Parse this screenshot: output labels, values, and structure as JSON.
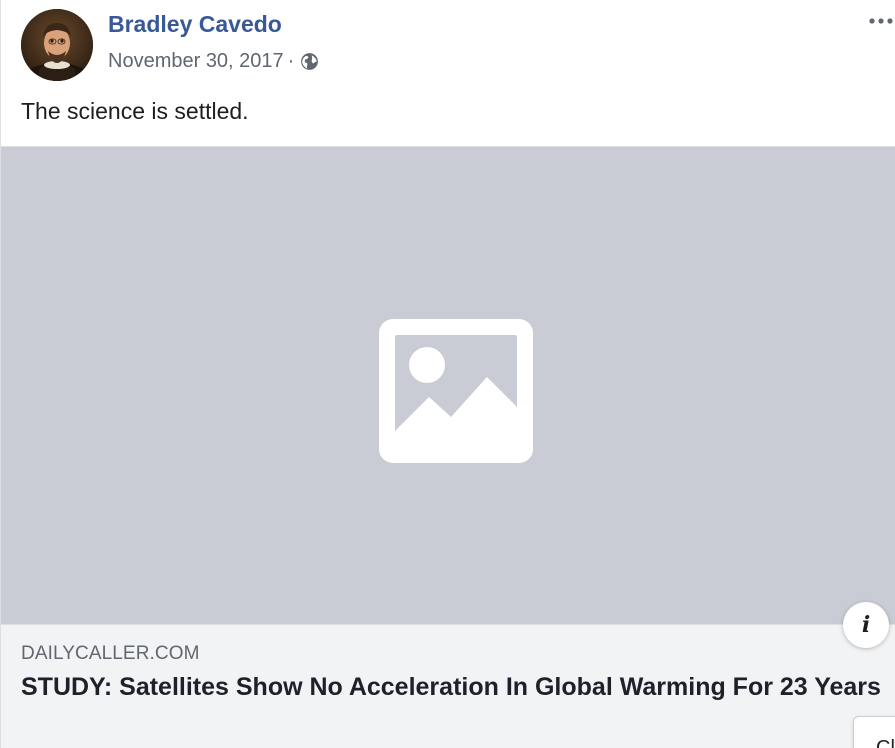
{
  "post": {
    "author": "Bradley Cavedo",
    "date": "November 30, 2017",
    "separator": "·",
    "privacy_icon": "globe-icon",
    "more_icon": "more-options-icon",
    "text": "The science is settled."
  },
  "link_preview": {
    "image_icon": "image-placeholder-icon",
    "domain": "DAILYCALLER.COM",
    "headline": "STUDY: Satellites Show No Acceleration In Global Warming For 23 Years",
    "info_label": "i"
  },
  "popup": {
    "partial_text": "Cl"
  },
  "colors": {
    "author_link": "#385898",
    "meta_text": "#606770",
    "placeholder_bg": "#c9ccd4",
    "caption_bg": "#f2f3f5"
  }
}
